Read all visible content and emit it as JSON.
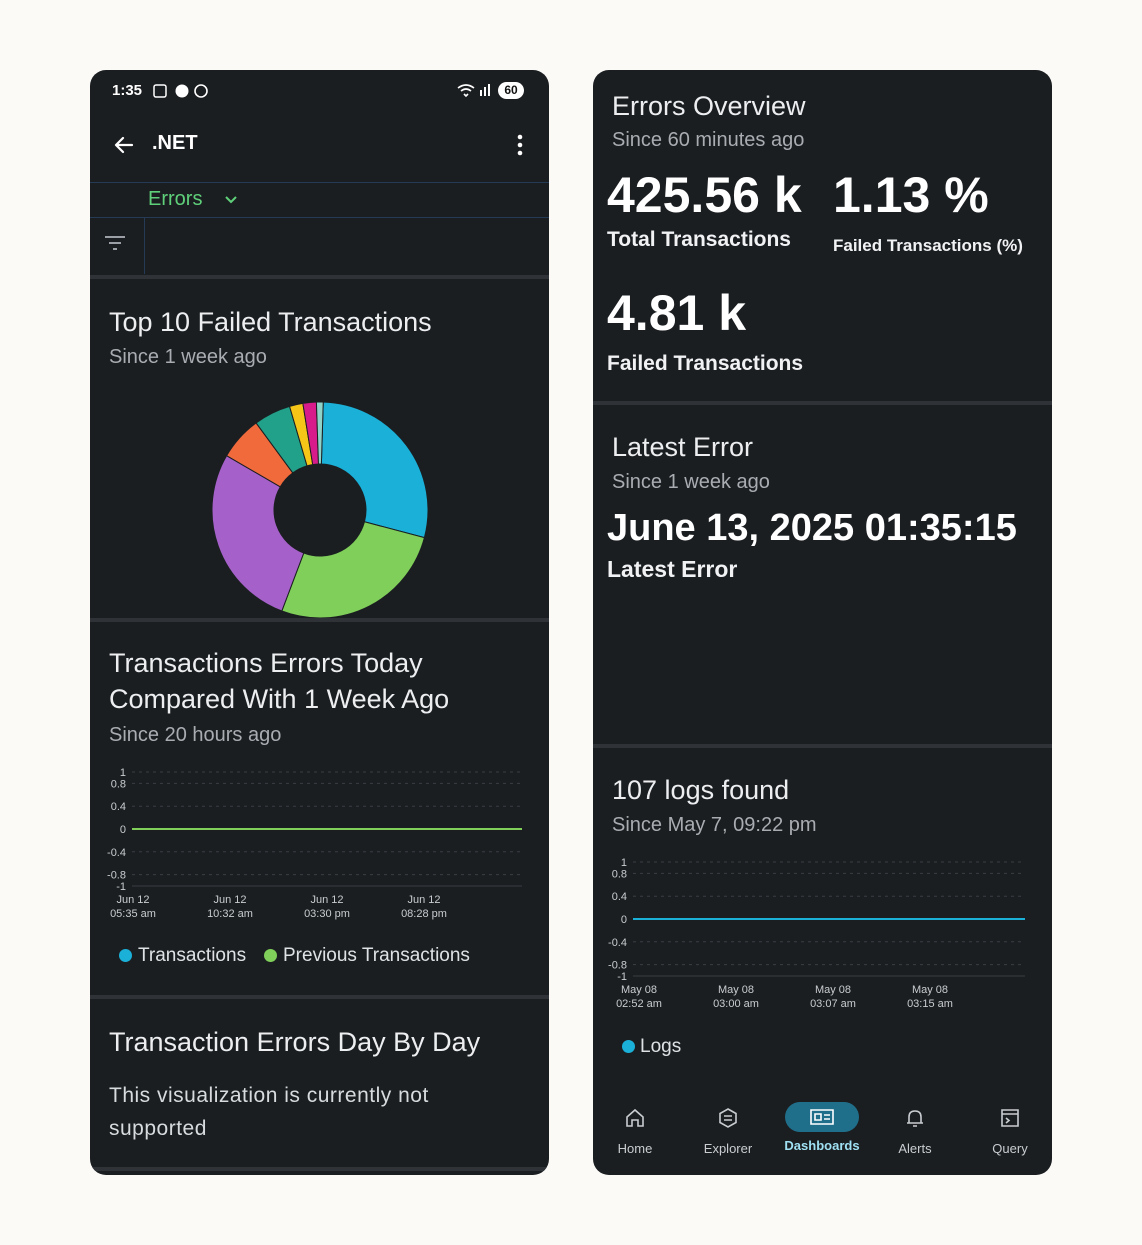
{
  "status_bar": {
    "time": "1:35",
    "battery": "60"
  },
  "header": {
    "title": ".NET"
  },
  "dropdown": {
    "label": "Errors"
  },
  "pie_card": {
    "title": "Top 10 Failed Transactions",
    "subtitle": "Since 1 week ago"
  },
  "compare_card": {
    "title_line1": "Transactions Errors Today",
    "title_line2": "Compared With 1 Week Ago",
    "subtitle": "Since 20 hours ago",
    "legend": [
      "Transactions",
      "Previous Transactions"
    ]
  },
  "day_card": {
    "title": "Transaction Errors Day By Day",
    "message_line1": "This visualization is currently not",
    "message_line2": "supported"
  },
  "overview": {
    "title": "Errors Overview",
    "subtitle": "Since 60 minutes ago",
    "total_value": "425.56 k",
    "total_label": "Total Transactions",
    "pct_value": "1.13 %",
    "pct_label": "Failed Transactions (%)",
    "failed_value": "4.81 k",
    "failed_label": "Failed Transactions"
  },
  "latest": {
    "title": "Latest Error",
    "subtitle": "Since 1 week ago",
    "value": "June 13, 2025 01:35:15",
    "label": "Latest Error"
  },
  "logs": {
    "title": "107 logs found",
    "subtitle": "Since May 7, 09:22 pm",
    "legend": "Logs"
  },
  "bottom_nav": [
    "Home",
    "Explorer",
    "Dashboards",
    "Alerts",
    "Query"
  ],
  "colors": {
    "background": "#1b1e21",
    "accent_green": "#5fd07a",
    "nav_active": "#1f6f8b",
    "pie": [
      "#1ab0d8",
      "#7fcf5a",
      "#a561c9",
      "#f06a3c",
      "#21a08a",
      "#f5c518",
      "#d81b8a",
      "#8fd3c8"
    ]
  },
  "chart_data": [
    {
      "type": "pie",
      "variant": "donut",
      "title": "Top 10 Failed Transactions",
      "categories": [],
      "values": [
        28.5,
        26.5,
        27.5,
        6.5,
        5.5,
        2,
        2,
        1
      ],
      "colors": [
        "#1ab0d8",
        "#7fcf5a",
        "#a561c9",
        "#f06a3c",
        "#21a08a",
        "#f5c518",
        "#d81b8a",
        "#8fd3c8"
      ]
    },
    {
      "type": "line",
      "title": "Transactions Errors Today Compared With 1 Week Ago",
      "x": [
        "Jun 12 05:35 am",
        "Jun 12 10:32 am",
        "Jun 12 03:30 pm",
        "Jun 12 08:28 pm"
      ],
      "x_ticks": [
        [
          "Jun 12",
          "05:35 am"
        ],
        [
          "Jun 12",
          "10:32 am"
        ],
        [
          "Jun 12",
          "03:30 pm"
        ],
        [
          "Jun 12",
          "08:28 pm"
        ]
      ],
      "y_ticks": [
        "1",
        "0.8",
        "0.4",
        "0",
        "-0.4",
        "-0.8",
        "-1"
      ],
      "ylim": [
        -1,
        1
      ],
      "series": [
        {
          "name": "Transactions",
          "color": "#1ab0d8",
          "values": []
        },
        {
          "name": "Previous Transactions",
          "color": "#7fcf5a",
          "values": [
            0,
            0,
            0,
            0
          ]
        }
      ],
      "grid": true,
      "legend": "bottom"
    },
    {
      "type": "line",
      "title": "107 logs found",
      "x": [
        "May 08 02:52 am",
        "May 08 03:00 am",
        "May 08 03:07 am",
        "May 08 03:15 am"
      ],
      "x_ticks": [
        [
          "May 08",
          "02:52 am"
        ],
        [
          "May 08",
          "03:00 am"
        ],
        [
          "May 08",
          "03:07 am"
        ],
        [
          "May 08",
          "03:15 am"
        ]
      ],
      "y_ticks": [
        "1",
        "0.8",
        "0.4",
        "0",
        "-0.4",
        "-0.8",
        "-1"
      ],
      "ylim": [
        -1,
        1
      ],
      "series": [
        {
          "name": "Logs",
          "color": "#1ab0d8",
          "values": [
            0,
            0,
            0,
            0
          ]
        }
      ],
      "grid": true,
      "legend": "bottom"
    }
  ]
}
